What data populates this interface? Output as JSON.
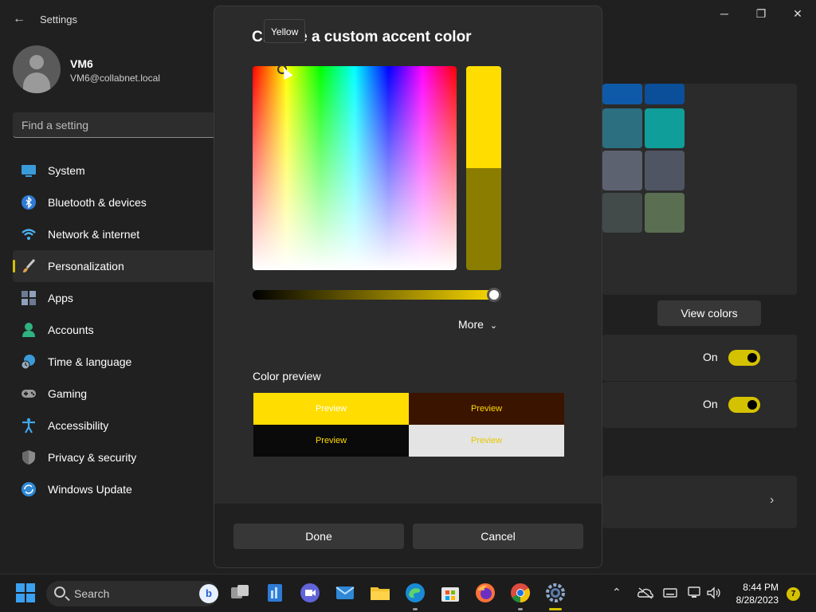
{
  "window": {
    "title": "Settings",
    "back_icon": "back-arrow-icon",
    "minimize": "─",
    "maximize": "❐",
    "close": "✕"
  },
  "user": {
    "name": "VM6",
    "email": "VM6@collabnet.local"
  },
  "search": {
    "placeholder": "Find a setting"
  },
  "sidebar": {
    "items": [
      {
        "label": "System",
        "icon": "system-icon",
        "color": "#3a9bd9"
      },
      {
        "label": "Bluetooth & devices",
        "icon": "bluetooth-icon",
        "color": "#2e7bd6"
      },
      {
        "label": "Network & internet",
        "icon": "wifi-icon",
        "color": "#4ab0f0"
      },
      {
        "label": "Personalization",
        "icon": "brush-icon",
        "color": "#e0a050",
        "active": true
      },
      {
        "label": "Apps",
        "icon": "apps-icon",
        "color": "#8a9bb5"
      },
      {
        "label": "Accounts",
        "icon": "accounts-icon",
        "color": "#2fb380"
      },
      {
        "label": "Time & language",
        "icon": "globe-clock-icon",
        "color": "#3a9bd9"
      },
      {
        "label": "Gaming",
        "icon": "gamepad-icon",
        "color": "#9a9a9a"
      },
      {
        "label": "Accessibility",
        "icon": "accessibility-icon",
        "color": "#3fa6e8"
      },
      {
        "label": "Privacy & security",
        "icon": "shield-icon",
        "color": "#8a8a8a"
      },
      {
        "label": "Windows Update",
        "icon": "update-icon",
        "color": "#2e88d6"
      }
    ]
  },
  "background": {
    "view_colors": "View colors",
    "toggle1": "On",
    "toggle2": "On"
  },
  "dialog": {
    "title": "Choose a custom accent color",
    "tooltip": "Yellow",
    "more": "More",
    "preview_label": "Color preview",
    "preview": [
      "Preview",
      "Preview",
      "Preview",
      "Preview"
    ],
    "done": "Done",
    "cancel": "Cancel",
    "new_color": "#ffdd00",
    "old_color": "#8b7d00"
  },
  "taskbar": {
    "search_label": "Search",
    "time": "8:44 PM",
    "date": "8/28/2023",
    "notifications": "7"
  }
}
